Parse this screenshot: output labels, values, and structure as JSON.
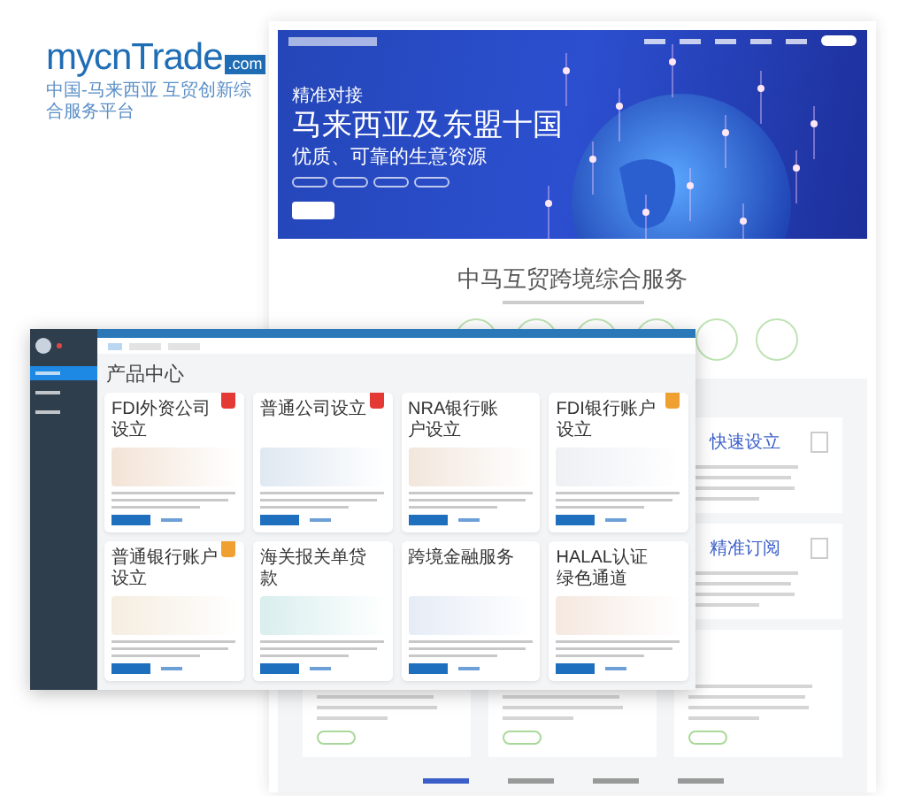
{
  "logo": {
    "name": "mycnTrade",
    "domain": ".com",
    "tagline": "中国-马来西亚 互贸创新综合服务平台"
  },
  "website": {
    "hero": {
      "kicker": "精准对接",
      "headline": "马来西亚及东盟十国",
      "subline": "优质、可靠的生意资源"
    },
    "section_title": "中马互贸跨境综合服务",
    "bottom_tabs": [
      {
        "selected": true
      },
      {
        "selected": false
      },
      {
        "selected": false
      },
      {
        "selected": false
      }
    ],
    "service_cards": [
      {
        "title": "快速设立"
      },
      {
        "title": "精准订阅"
      }
    ]
  },
  "dashboard": {
    "sidebar": {
      "items": [
        {
          "selected": true
        },
        {
          "selected": false
        },
        {
          "selected": false
        }
      ]
    },
    "tabs": [
      {
        "selected": true
      },
      {
        "selected": false
      },
      {
        "selected": false
      }
    ],
    "heading": "产品中心",
    "products": [
      {
        "title": "FDI外资公司设立",
        "color": "#e53935"
      },
      {
        "title": "普通公司设立",
        "color": "#e53935"
      },
      {
        "title": "NRA银行账户设立"
      },
      {
        "title": "FDI银行账户设立",
        "color": "#f0a030"
      },
      {
        "title": "普通银行账户设立",
        "color": "#f0a030"
      },
      {
        "title": "海关报关单贷款"
      },
      {
        "title": "跨境金融服务"
      },
      {
        "title": "HALAL认证绿色通道"
      }
    ]
  }
}
